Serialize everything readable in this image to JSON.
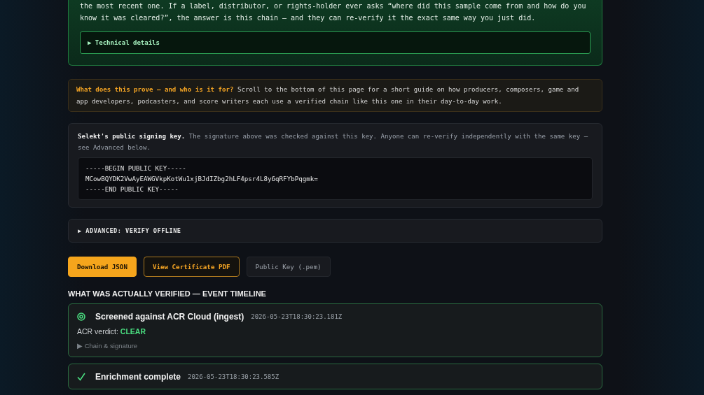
{
  "intro": {
    "text": "the most recent one. If a label, distributor, or rights-holder ever asks “where did this sample come from and how do you know it was cleared?”, the answer is this chain — and they can re-verify it the exact same way you just did.",
    "details": {
      "marker": "▶",
      "label": "Technical details"
    }
  },
  "note": {
    "text": "**What does this prove — and who is it for?** Scroll to the bottom of this page for a short guide on how producers, composers, game and app developers, podcasters, and score writers each use a verified chain like this one in their day-to-day work."
  },
  "signing_key": {
    "text": "**Selekt's public signing key.** The signature above was checked against this key. Anyone can re-verify independently with the same key — see Advanced below.",
    "lines": [
      "-----BEGIN PUBLIC KEY-----",
      "MCowBQYDK2VwAyEAWGVkpKotWu1xjBJdIZbg2hLF4psr4L8y6qRFYbPqgmk=",
      "-----END PUBLIC KEY-----"
    ]
  },
  "advanced": {
    "marker": "▶",
    "label": "ADVANCED: VERIFY OFFLINE"
  },
  "buttons": [
    {
      "label": "Download JSON",
      "kind": "primary"
    },
    {
      "label": "View Certificate PDF",
      "kind": "outline"
    },
    {
      "label": "Public Key (.pem)",
      "kind": "ghost"
    }
  ],
  "timeline": {
    "heading": "WHAT WAS ACTUALLY VERIFIED — EVENT TIMELINE",
    "events": [
      {
        "kind": "screened",
        "title": "Screened against ACR Cloud (ingest)",
        "time": "2026-05-23T18:30:23.181Z",
        "verdict_label": "ACR verdict:",
        "verdict": "CLEAR",
        "expander": "▶ Chain & signature"
      },
      {
        "kind": "done",
        "title": "Enrichment complete",
        "time": "2026-05-23T18:30:23.585Z"
      }
    ]
  }
}
